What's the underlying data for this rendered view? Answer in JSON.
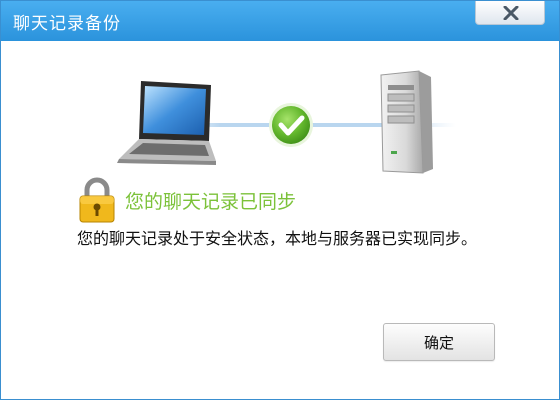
{
  "window": {
    "title": "聊天记录备份"
  },
  "icons": {
    "close": "close-icon",
    "laptop": "laptop-icon",
    "check": "check-icon",
    "server": "server-icon",
    "lock": "lock-icon"
  },
  "status": {
    "title": "您的聊天记录已同步",
    "message": "您的聊天记录处于安全状态，本地与服务器已实现同步。"
  },
  "buttons": {
    "ok_label": "确定"
  },
  "colors": {
    "titlebar": "#2b93dc",
    "status_green": "#7cc23a",
    "check_green": "#5bb030"
  }
}
